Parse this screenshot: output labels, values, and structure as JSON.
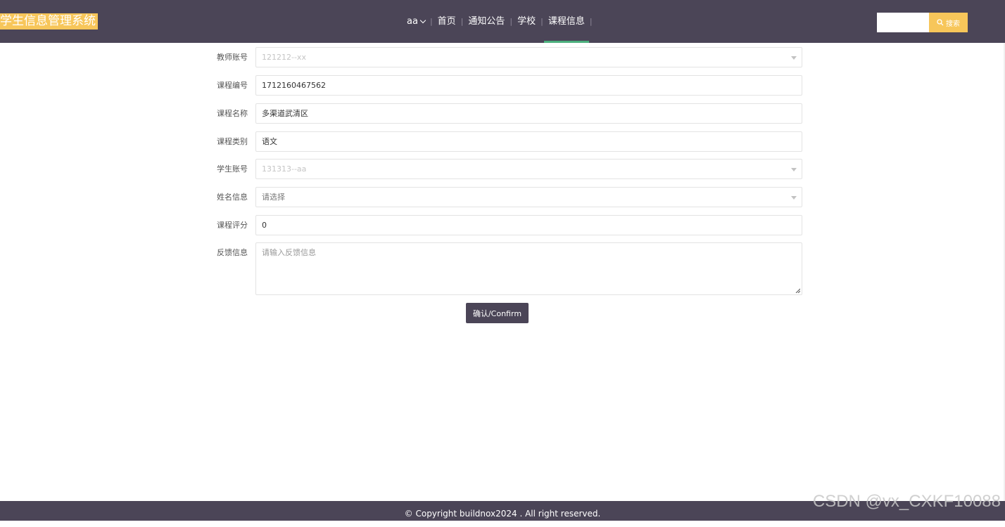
{
  "header": {
    "logo": "学生信息管理系统",
    "user": "aa",
    "nav": [
      "首页",
      "通知公告",
      "学校",
      "课程信息"
    ],
    "active_nav": "课程信息",
    "search_button": "搜索",
    "search_icon": "search-icon"
  },
  "form": {
    "fields": [
      {
        "label": "教师账号",
        "value": "121212--xx",
        "state": "disabled-select"
      },
      {
        "label": "课程编号",
        "value": "1712160467562",
        "state": "input"
      },
      {
        "label": "课程名称",
        "value": "多渠道武清区",
        "state": "input"
      },
      {
        "label": "课程类别",
        "value": "语文",
        "state": "input"
      },
      {
        "label": "学生账号",
        "value": "131313--aa",
        "state": "disabled-select"
      },
      {
        "label": "姓名信息",
        "value": "请选择",
        "state": "select"
      },
      {
        "label": "课程评分",
        "value": "0",
        "state": "input"
      }
    ],
    "feedback_label": "反馈信息",
    "feedback_placeholder": "请输入反馈信息",
    "confirm_label": "确认/Confirm"
  },
  "footer": {
    "copyright": "© Copyright buildnox2024 . All right reserved."
  },
  "watermark": "CSDN @vx_CXKF10088",
  "colors": {
    "header_bg": "#4b4557",
    "accent_yellow": "#f7c65a",
    "active_underline": "#4caf7d"
  }
}
